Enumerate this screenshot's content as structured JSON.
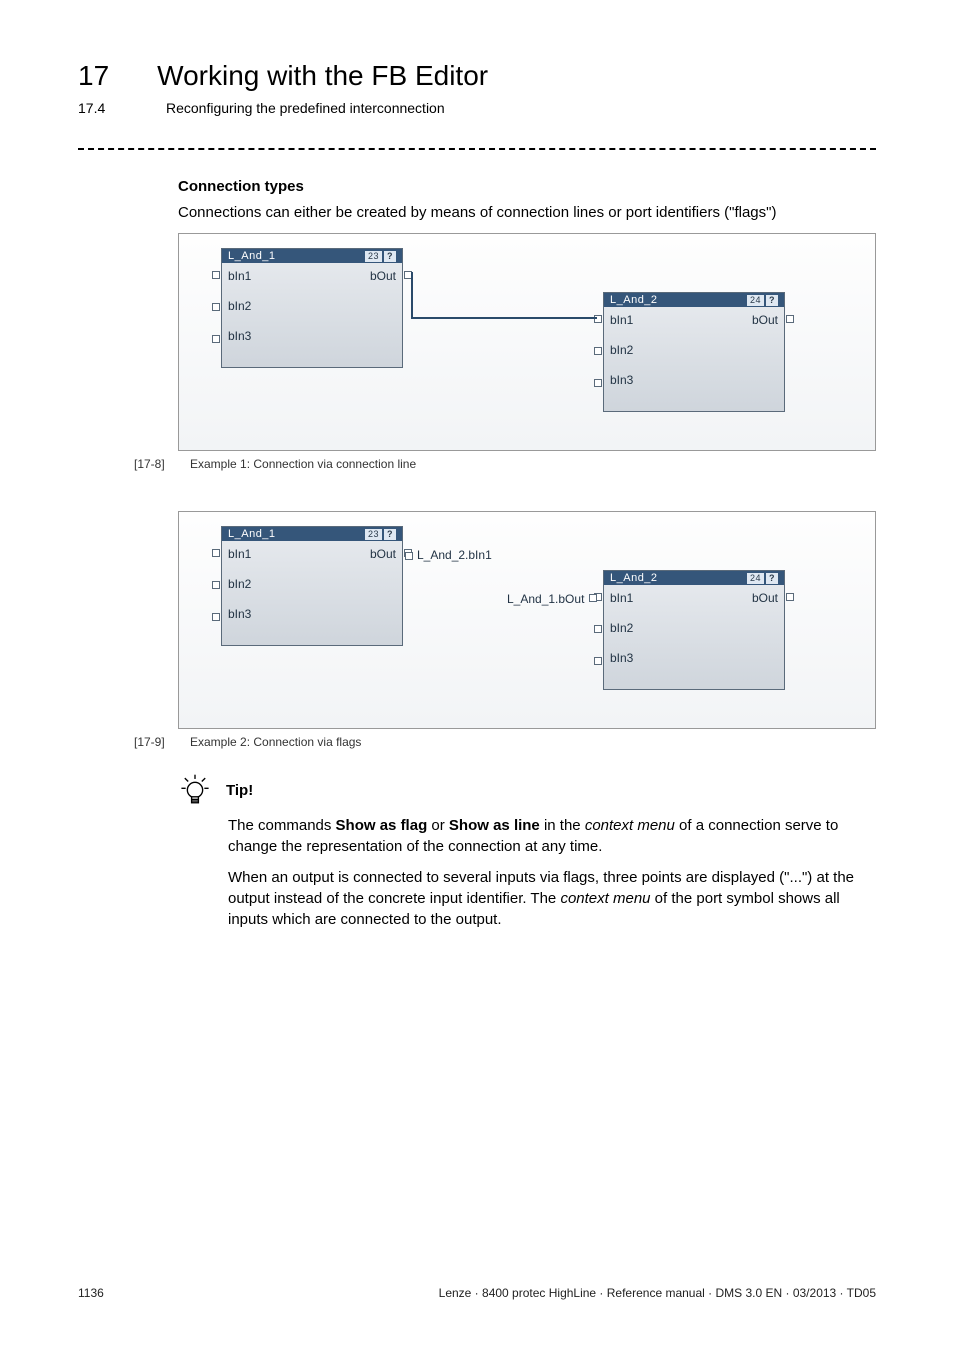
{
  "header": {
    "chapter_number": "17",
    "chapter_title": "Working with the FB Editor",
    "section_number": "17.4",
    "section_title": "Reconfiguring the predefined interconnection"
  },
  "section": {
    "heading": "Connection types",
    "intro": "Connections can either be created by means of connection lines or port identifiers (\"flags\")"
  },
  "figure1": {
    "caption_num": "[17-8]",
    "caption_text": "Example 1: Connection via connection line",
    "block1": {
      "title": "L_And_1",
      "idx": "23",
      "in": [
        "bIn1",
        "bIn2",
        "bIn3"
      ],
      "out": "bOut"
    },
    "block2": {
      "title": "L_And_2",
      "idx": "24",
      "in": [
        "bIn1",
        "bIn2",
        "bIn3"
      ],
      "out": "bOut"
    }
  },
  "figure2": {
    "caption_num": "[17-9]",
    "caption_text": "Example 2: Connection via flags",
    "block1": {
      "title": "L_And_1",
      "idx": "23",
      "in": [
        "bIn1",
        "bIn2",
        "bIn3"
      ],
      "out": "bOut"
    },
    "block2": {
      "title": "L_And_2",
      "idx": "24",
      "in": [
        "bIn1",
        "bIn2",
        "bIn3"
      ],
      "out": "bOut"
    },
    "flag_out": "L_And_2.bIn1",
    "flag_in": "L_And_1.bOut"
  },
  "tip": {
    "label": "Tip!",
    "p1a": "The commands ",
    "p1b": "Show as flag",
    "p1c": " or ",
    "p1d": "Show as line",
    "p1e": " in the ",
    "p1f": "context menu",
    "p1g": " of a connection serve to change the representation of the connection at any time.",
    "p2a": "When an output is connected to several inputs via flags, three points are displayed (\"...\") at the output instead of the concrete input identifier. The ",
    "p2b": "context menu",
    "p2c": " of the port symbol shows all inputs which are connected to the output."
  },
  "footer": {
    "page": "1136",
    "info": "Lenze · 8400 protec HighLine · Reference manual · DMS 3.0 EN · 03/2013 · TD05"
  }
}
